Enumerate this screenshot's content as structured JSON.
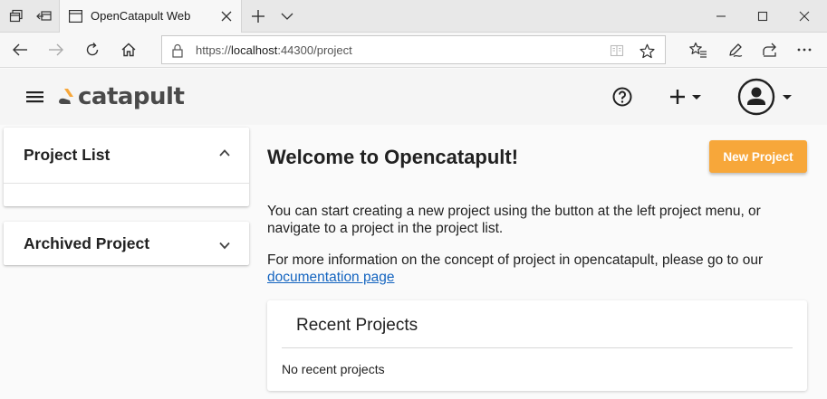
{
  "browser": {
    "tab_title": "OpenCatapult Web",
    "url_prefix": "https://",
    "url_host": "localhost",
    "url_rest": ":44300/project"
  },
  "app": {
    "logo_text": "catapult",
    "colors": {
      "accent": "#f7a73a",
      "link": "#1565c0",
      "logo": "#4a4a4a"
    }
  },
  "sidebar": {
    "panels": [
      {
        "title": "Project List",
        "expanded": true,
        "icon": "chevron-up-icon"
      },
      {
        "title": "Archived Project",
        "expanded": false,
        "icon": "chevron-down-icon"
      }
    ]
  },
  "main": {
    "heading": "Welcome to Opencatapult!",
    "new_project_label": "New Project",
    "intro": "You can start creating a new project using the button at the left project menu, or navigate to a project in the project list.",
    "more_info_text": "For more information on the concept of project in opencatapult, please go to our",
    "more_info_link": "documentation page",
    "recent": {
      "title": "Recent Projects",
      "empty_text": "No recent projects"
    }
  },
  "icons": [
    "tab-actions-icon",
    "set-aside-tabs-icon",
    "page-icon",
    "close-icon",
    "new-tab-icon",
    "tab-list-chevron-icon",
    "minimize-icon",
    "maximize-icon",
    "close-window-icon",
    "back-icon",
    "forward-icon",
    "refresh-icon",
    "home-icon",
    "lock-icon",
    "reading-view-icon",
    "favorite-star-icon",
    "favorites-icon",
    "pen-icon",
    "share-icon",
    "more-icon",
    "menu-icon",
    "help-icon",
    "plus-icon",
    "account-icon"
  ]
}
